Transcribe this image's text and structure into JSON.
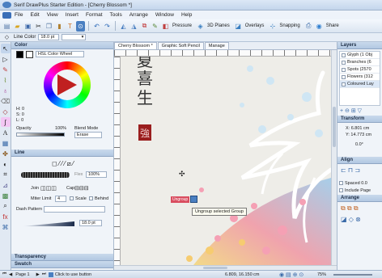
{
  "title_bar": {
    "title": "Serif DrawPlus Starter Edition - [Cherry Blossom *]"
  },
  "menu": [
    "File",
    "Edit",
    "View",
    "Insert",
    "Format",
    "Tools",
    "Arrange",
    "Window",
    "Help"
  ],
  "toolbar": {
    "pressure_label": "Pressure",
    "planes_label": "3D Planes",
    "overlays_label": "Overlays",
    "snapping_label": "Snapping",
    "share_label": "Share"
  },
  "context_bar": {
    "line_color_label": "Line Color",
    "line_width": "18.0 pt"
  },
  "doc_tabs": [
    "Cherry Blossom *",
    "Graphic Soft Pencil",
    "Manage"
  ],
  "color_panel": {
    "title": "Color",
    "mode": "HSL Color Wheel",
    "h": "H: 0",
    "s": "S: 0",
    "l": "L: 0",
    "opacity_label": "Opacity",
    "opacity_value": "100%",
    "blend_label": "Blend Mode",
    "blend_value": "Erase"
  },
  "line_panel": {
    "title": "Line",
    "flex_label": "Flex",
    "flex_value": "100%",
    "join_label": "Join",
    "cap_label": "Cap",
    "miter_label": "Miter Limit",
    "miter_value": "4",
    "scale_label": "Scale",
    "behind_label": "Behind",
    "dash_label": "Dash Pattern",
    "width_value": "18.0 pt"
  },
  "bottom_panels": {
    "transparency": "Transparency",
    "swatch": "Swatch"
  },
  "canvas": {
    "kanji_1": "夏",
    "kanji_2": "喜",
    "kanji_3": "生",
    "kanji_4": "強",
    "ungroup_badge": "Ungroup",
    "tooltip": "Ungroup selected Group"
  },
  "layers_panel": {
    "title": "Layers",
    "items": [
      "Glyph (1 Obj",
      "Branches (6",
      "Spots (2570",
      "Flowers (312",
      "Coloured Lay"
    ]
  },
  "transform_panel": {
    "title": "Transform",
    "x": "X: 6.801 cm",
    "y": "Y: 14.773 cm",
    "rotation": "0.0°"
  },
  "align_panel": {
    "title": "Align",
    "spaced_label": "Spaced",
    "spaced_value": "0.0",
    "include_page_label": "Include Page"
  },
  "arrange_panel": {
    "title": "Arrange"
  },
  "status": {
    "page": "Page 1",
    "hint": "Click to use button",
    "coords": "6.809, 16.150 cm",
    "zoom": "75%"
  },
  "colors": {
    "accent": "#4a7fc1",
    "title_bg": "#c4d6ec",
    "seal_red": "#9a1e1e",
    "badge_red": "#d94d5f"
  }
}
